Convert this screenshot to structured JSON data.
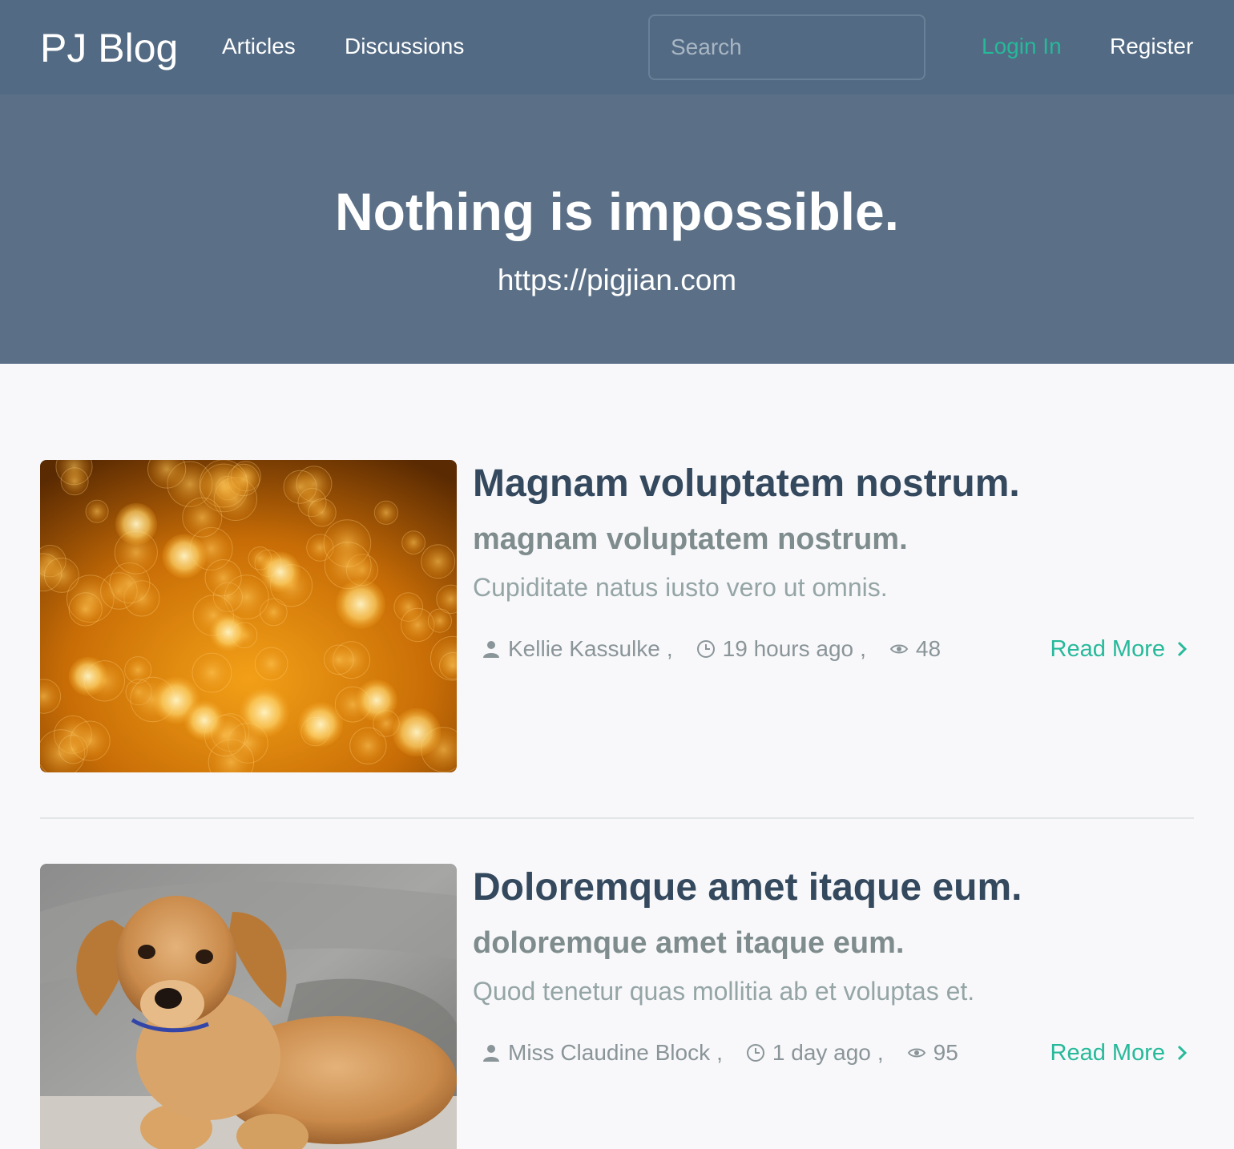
{
  "navbar": {
    "brand": "PJ Blog",
    "links": {
      "articles": "Articles",
      "discussions": "Discussions"
    },
    "search_placeholder": "Search",
    "login": "Login In",
    "register": "Register"
  },
  "hero": {
    "title": "Nothing is impossible.",
    "subtitle": "https://pigjian.com"
  },
  "articles": [
    {
      "title": "Magnam voluptatem nostrum.",
      "subtitle": "magnam voluptatem nostrum.",
      "excerpt": "Cupiditate natus iusto vero ut omnis.",
      "author": "Kellie Kassulke",
      "time": "19 hours ago",
      "views": "48",
      "read_more": "Read More"
    },
    {
      "title": "Doloremque amet itaque eum.",
      "subtitle": "doloremque amet itaque eum.",
      "excerpt": "Quod tenetur quas mollitia ab et voluptas et.",
      "author": "Miss Claudine Block",
      "time": "1 day ago",
      "views": "95",
      "read_more": "Read More"
    }
  ],
  "colors": {
    "navbar": "#526a83",
    "hero": "#5b7087",
    "accent": "#26b99a",
    "title": "#34495e"
  },
  "icons": [
    "user-icon",
    "clock-icon",
    "eye-icon",
    "chevron-right-icon"
  ]
}
